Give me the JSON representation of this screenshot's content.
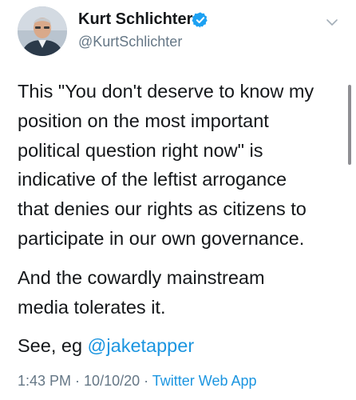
{
  "user": {
    "display_name": "Kurt Schlichter",
    "handle": "@KurtSchlichter",
    "verified": true
  },
  "tweet": {
    "paragraphs": [
      [
        "This \"You don't deserve to know my",
        "position on the most important",
        "political question right now\" is",
        "indicative of the leftist arrogance",
        "that denies our rights as citizens to",
        "participate in our own governance."
      ],
      [
        "And the cowardly mainstream",
        "media tolerates it."
      ]
    ],
    "see_prefix": "See, eg ",
    "mention": "@jaketapper"
  },
  "meta": {
    "time": "1:43 PM",
    "separator": " · ",
    "date": "10/10/20",
    "source": "Twitter Web App"
  },
  "colors": {
    "accent": "#1b95e0",
    "secondary_text": "#657786",
    "primary_text": "#14171a"
  },
  "icons": {
    "verified": "verified-badge-icon",
    "more": "chevron-down-icon"
  }
}
